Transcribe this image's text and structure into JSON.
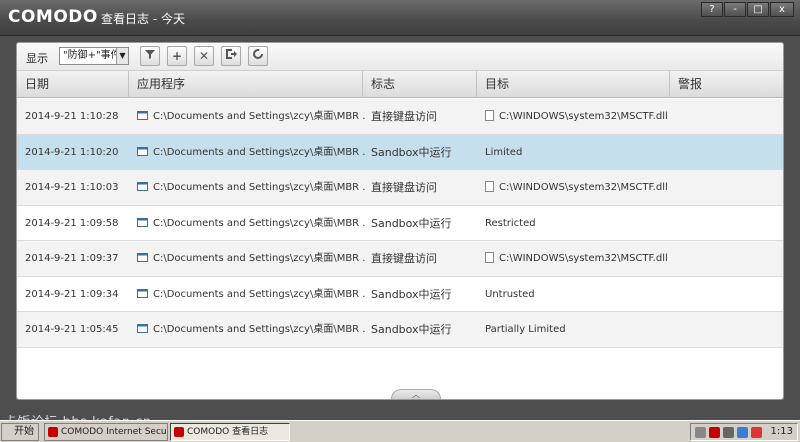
{
  "window": {
    "logo": "COMODO",
    "title": "查看日志 - 今天",
    "buttons": [
      "?",
      "-",
      "□",
      "x"
    ]
  },
  "toolbar": {
    "show_label": "显示",
    "filter_value": "\"防御+\"事件",
    "icons": [
      "filter-icon",
      "add-icon",
      "delete-icon",
      "export-icon",
      "refresh-icon"
    ]
  },
  "table": {
    "columns": [
      "日期",
      "应用程序",
      "标志",
      "目标",
      "警报"
    ],
    "rows": [
      {
        "date": "2014-9-21 1:10:28",
        "app": "C:\\Documents and Settings\\zcy\\桌面\\MBR ...",
        "flag": "直接键盘访问",
        "target": "C:\\WINDOWS\\system32\\MSCTF.dll",
        "target_icon": "file-icon"
      },
      {
        "date": "2014-9-21 1:10:20",
        "app": "C:\\Documents and Settings\\zcy\\桌面\\MBR ...",
        "flag": "Sandbox中运行",
        "target": "Limited",
        "target_icon": ""
      },
      {
        "date": "2014-9-21 1:10:03",
        "app": "C:\\Documents and Settings\\zcy\\桌面\\MBR ...",
        "flag": "直接键盘访问",
        "target": "C:\\WINDOWS\\system32\\MSCTF.dll",
        "target_icon": "file-icon"
      },
      {
        "date": "2014-9-21 1:09:58",
        "app": "C:\\Documents and Settings\\zcy\\桌面\\MBR ...",
        "flag": "Sandbox中运行",
        "target": "Restricted",
        "target_icon": ""
      },
      {
        "date": "2014-9-21 1:09:37",
        "app": "C:\\Documents and Settings\\zcy\\桌面\\MBR ...",
        "flag": "直接键盘访问",
        "target": "C:\\WINDOWS\\system32\\MSCTF.dll",
        "target_icon": "file-icon"
      },
      {
        "date": "2014-9-21 1:09:34",
        "app": "C:\\Documents and Settings\\zcy\\桌面\\MBR ...",
        "flag": "Sandbox中运行",
        "target": "Untrusted",
        "target_icon": ""
      },
      {
        "date": "2014-9-21 1:05:45",
        "app": "C:\\Documents and Settings\\zcy\\桌面\\MBR ...",
        "flag": "Sandbox中运行",
        "target": "Partially Limited",
        "target_icon": ""
      }
    ],
    "selected_index": 1
  },
  "taskbar": {
    "start": "开始",
    "tasks": [
      "COMODO Internet Secur...",
      "COMODO 查看日志"
    ],
    "clock": "1:13",
    "watermark": "卡饭论坛 bbs.kafan.cn"
  },
  "colors": {
    "selected_row": "#c6dfed",
    "titlebar": "#4a4a4a"
  }
}
